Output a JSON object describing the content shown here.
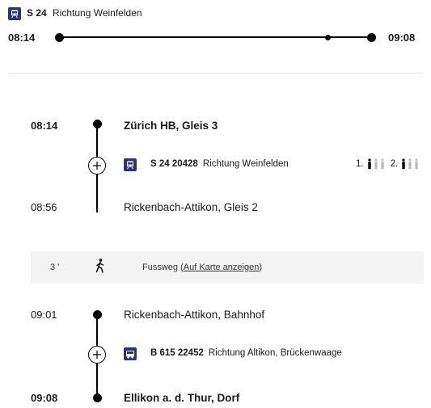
{
  "header": {
    "train_icon": "train-icon",
    "line": "S 24",
    "direction": "Richtung Weinfelden"
  },
  "summary": {
    "departure": "08:14",
    "arrival": "09:08"
  },
  "sections": [
    {
      "from": {
        "time": "08:14",
        "name": "Zürich HB, Gleis 3"
      },
      "service": {
        "icon": "train-icon",
        "number": "S 24 20428",
        "direction": "Richtung Weinfelden"
      },
      "occupancy": {
        "first_label": "1.",
        "second_label": "2.",
        "level_first": 1,
        "level_second": 1
      },
      "to": {
        "time": "08:56",
        "name": "Rickenbach-Attikon, Gleis 2"
      }
    },
    {
      "from": {
        "time": "09:01",
        "name": "Rickenbach-Attikon, Bahnhof"
      },
      "service": {
        "icon": "bus-icon",
        "number": "B 615 22452",
        "direction": "Richtung Altikon, Brückenwaage"
      },
      "to": {
        "time": "09:08",
        "name": "Ellikon a. d. Thur, Dorf"
      }
    }
  ],
  "walk": {
    "duration": "3 '",
    "icon": "walking-icon",
    "label": "Fussweg",
    "open_paren": "(",
    "link": "Auf Karte anzeigen",
    "close_paren": ")"
  },
  "colors": {
    "sbb_blue": "#2d327d",
    "walk_background": "#f3f3f3",
    "divider": "#e5e5e5"
  }
}
